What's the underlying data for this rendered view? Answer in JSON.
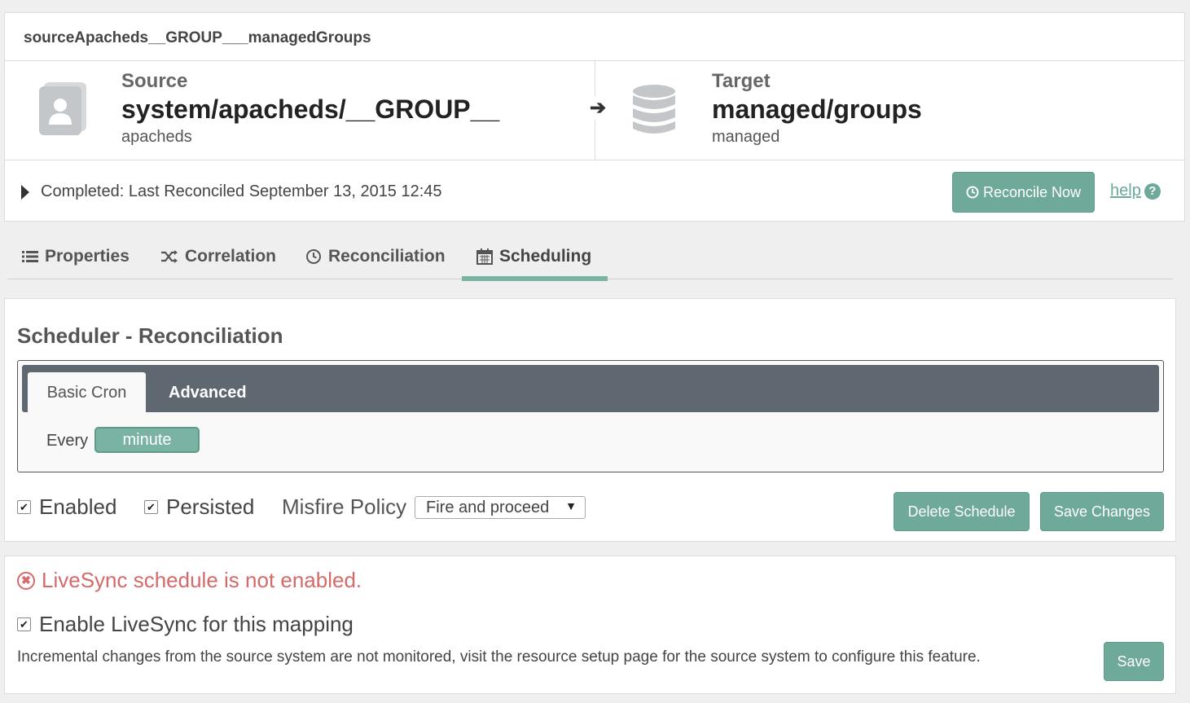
{
  "mapping": {
    "title": "sourceApacheds__GROUP___managedGroups",
    "source": {
      "label": "Source",
      "name": "system/apacheds/__GROUP__",
      "sub": "apacheds",
      "icon": "user-card-icon"
    },
    "target": {
      "label": "Target",
      "name": "managed/groups",
      "sub": "managed",
      "icon": "database-icon"
    },
    "status": "Completed: Last Reconciled September 13, 2015 12:45",
    "reconcile_label": "Reconcile Now",
    "help_label": "help"
  },
  "tabs": [
    {
      "label": "Properties",
      "icon": "list-icon"
    },
    {
      "label": "Correlation",
      "icon": "shuffle-icon"
    },
    {
      "label": "Reconciliation",
      "icon": "clock-icon"
    },
    {
      "label": "Scheduling",
      "icon": "calendar-icon",
      "active": true
    }
  ],
  "scheduler": {
    "title": "Scheduler - Reconciliation",
    "cron_tabs": {
      "basic": "Basic Cron",
      "advanced": "Advanced"
    },
    "every_label": "Every",
    "every_value": "minute",
    "enabled_label": "Enabled",
    "persisted_label": "Persisted",
    "misfire_label": "Misfire Policy",
    "misfire_value": "Fire and proceed",
    "delete_label": "Delete Schedule",
    "save_label": "Save Changes"
  },
  "livesync": {
    "warning": "LiveSync schedule is not enabled.",
    "enable_label": "Enable LiveSync for this mapping",
    "description": "Incremental changes from the source system are not monitored, visit the resource setup page for the source system to configure this feature.",
    "save_label": "Save"
  },
  "colors": {
    "accent": "#6ea99a",
    "error": "#d46a6a",
    "bar": "#5f6870"
  }
}
